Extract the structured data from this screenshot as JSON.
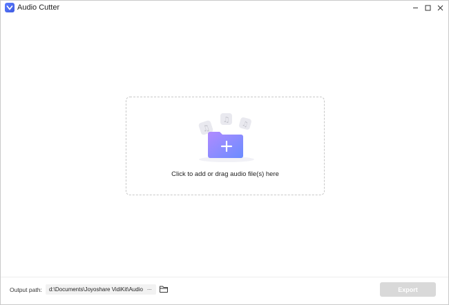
{
  "window": {
    "title": "Audio Cutter"
  },
  "dropzone": {
    "instruction": "Click to add or drag audio file(s) here"
  },
  "footer": {
    "output_label": "Output path:",
    "output_path": "d:\\Documents\\Joyoshare VidiKit\\Audio",
    "more_label": "···",
    "export_label": "Export",
    "export_enabled": false
  },
  "colors": {
    "brand": "#4a6cf7",
    "folder_gradient_start": "#b18bff",
    "folder_gradient_end": "#6a8cff",
    "export_disabled": "#d9d9d9"
  },
  "icons": {
    "app": "audio-cutter-logo-icon",
    "minimize": "minimize-icon",
    "maximize": "maximize-icon",
    "close": "close-icon",
    "add_file": "add-folder-icon",
    "browse": "folder-icon"
  }
}
